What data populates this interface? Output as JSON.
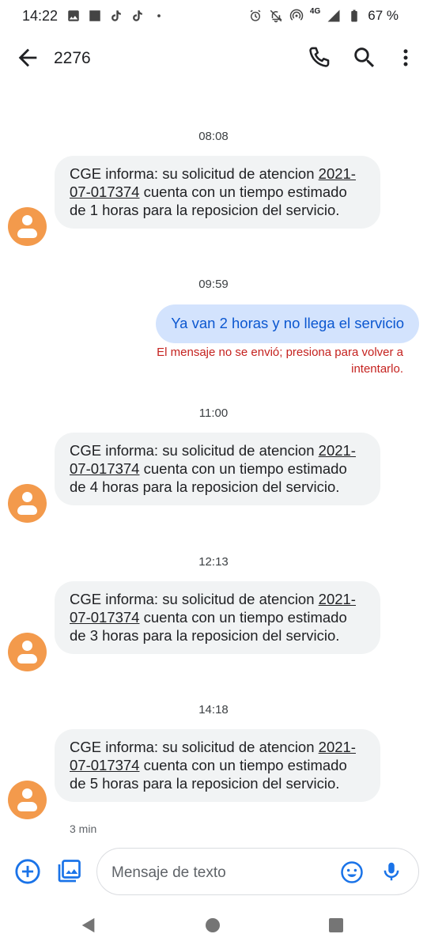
{
  "status_bar": {
    "time": "14:22",
    "left_icons": [
      "image-icon",
      "square-icon",
      "tiktok-icon",
      "tiktok-icon",
      "dot-icon"
    ],
    "right_icons": [
      "alarm-icon",
      "notifications-off-icon",
      "hotspot-icon",
      "signal-icon",
      "battery-icon"
    ],
    "network": "4G",
    "battery": "67 %"
  },
  "app_bar": {
    "title": "2276",
    "actions": [
      "call-icon",
      "search-icon",
      "more-vert-icon"
    ]
  },
  "messages": [
    {
      "type": "timestamp",
      "text": "08:08"
    },
    {
      "type": "incoming",
      "line1": "CGE informa: su solicitud de atencion",
      "ref": "2021-07-017374",
      "rest": " cuenta con un tiempo estimado de 1 horas para la reposicion del servicio."
    },
    {
      "type": "timestamp",
      "text": "09:59"
    },
    {
      "type": "outgoing",
      "text": "Ya van 2 horas y no llega el servicio",
      "error": "El mensaje no se envió; presiona para volver a intentarlo."
    },
    {
      "type": "timestamp",
      "text": "11:00"
    },
    {
      "type": "incoming",
      "line1": "CGE informa: su solicitud de atencion",
      "ref": "2021-07-017374",
      "rest": " cuenta con un tiempo estimado de 4 horas para la reposicion del servicio."
    },
    {
      "type": "timestamp",
      "text": "12:13"
    },
    {
      "type": "incoming",
      "line1": "CGE informa: su solicitud de atencion",
      "ref": "2021-07-017374",
      "rest": " cuenta con un tiempo estimado de 3 horas para la reposicion del servicio."
    },
    {
      "type": "timestamp",
      "text": "14:18"
    },
    {
      "type": "incoming",
      "line1": "CGE informa: su solicitud de atencion",
      "ref": "2021-07-017374",
      "rest": " cuenta con un tiempo estimado de 5 horas para la reposicion del servicio.",
      "meta": "3 min"
    }
  ],
  "composer": {
    "placeholder": "Mensaje de texto"
  },
  "colors": {
    "incoming_bubble": "#f1f3f4",
    "outgoing_bubble": "#d3e3fd",
    "outgoing_text": "#0b57d0",
    "error": "#c5221f",
    "avatar": "#f39a4c",
    "accent": "#1a73e8"
  }
}
